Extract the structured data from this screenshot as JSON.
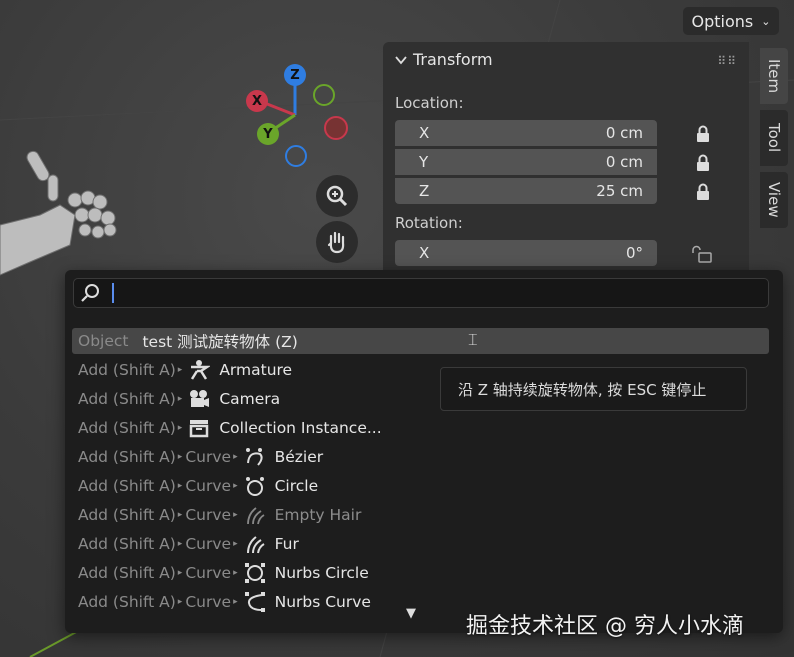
{
  "header": {
    "options_label": "Options"
  },
  "transform": {
    "title": "Transform",
    "location_label": "Location:",
    "location": [
      {
        "axis": "X",
        "value": "0 cm"
      },
      {
        "axis": "Y",
        "value": "0 cm"
      },
      {
        "axis": "Z",
        "value": "25 cm"
      }
    ],
    "rotation_label": "Rotation:",
    "rotation": [
      {
        "axis": "X",
        "value": "0°"
      }
    ]
  },
  "side_tabs": [
    "Item",
    "Tool",
    "View"
  ],
  "gizmo": {
    "z": "Z",
    "x": "X",
    "y": "Y"
  },
  "search": {
    "value": ""
  },
  "results": [
    {
      "prefix": "Object",
      "label": "test 测试旋转物体 (Z)",
      "icon": "none",
      "highlighted": true
    },
    {
      "prefix": "Add (Shift A)",
      "sub": "",
      "label": "Armature",
      "icon": "armature-icon"
    },
    {
      "prefix": "Add (Shift A)",
      "sub": "",
      "label": "Camera",
      "icon": "camera-icon"
    },
    {
      "prefix": "Add (Shift A)",
      "sub": "",
      "label": "Collection Instance...",
      "icon": "collection-icon"
    },
    {
      "prefix": "Add (Shift A)",
      "sub": "Curve",
      "label": "Bézier",
      "icon": "bezier-icon"
    },
    {
      "prefix": "Add (Shift A)",
      "sub": "Curve",
      "label": "Circle",
      "icon": "circle-curve-icon"
    },
    {
      "prefix": "Add (Shift A)",
      "sub": "Curve",
      "label": "Empty Hair",
      "icon": "empty-hair-icon",
      "dim": true
    },
    {
      "prefix": "Add (Shift A)",
      "sub": "Curve",
      "label": "Fur",
      "icon": "fur-icon"
    },
    {
      "prefix": "Add (Shift A)",
      "sub": "Curve",
      "label": "Nurbs Circle",
      "icon": "nurbs-circle-icon"
    },
    {
      "prefix": "Add (Shift A)",
      "sub": "Curve",
      "label": "Nurbs Curve",
      "icon": "nurbs-curve-icon"
    }
  ],
  "tooltip": "沿 Z 轴持续旋转物体, 按 ESC 键停止",
  "watermark": "掘金技术社区 @ 穷人小水滴",
  "colors": {
    "gizmo_x": "#c8384c",
    "gizmo_y": "#6aa52a",
    "gizmo_z": "#2f7de1",
    "caret": "#5a8dee"
  }
}
